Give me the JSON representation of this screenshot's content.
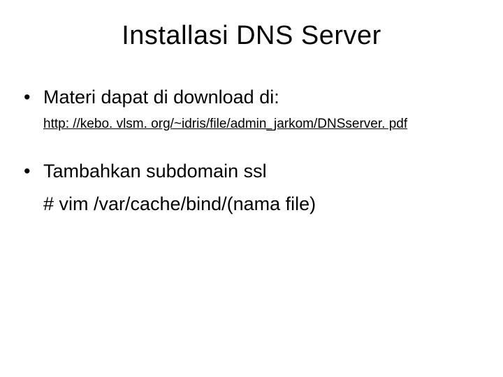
{
  "slide": {
    "title": "Installasi DNS Server",
    "bullets": [
      {
        "text": "Materi dapat di download di:",
        "sublink": "http: //kebo. vlsm. org/~idris/file/admin_jarkom/DNSserver. pdf"
      },
      {
        "text": "Tambahkan subdomain ssl",
        "line2": "# vim /var/cache/bind/(nama file)"
      }
    ]
  }
}
